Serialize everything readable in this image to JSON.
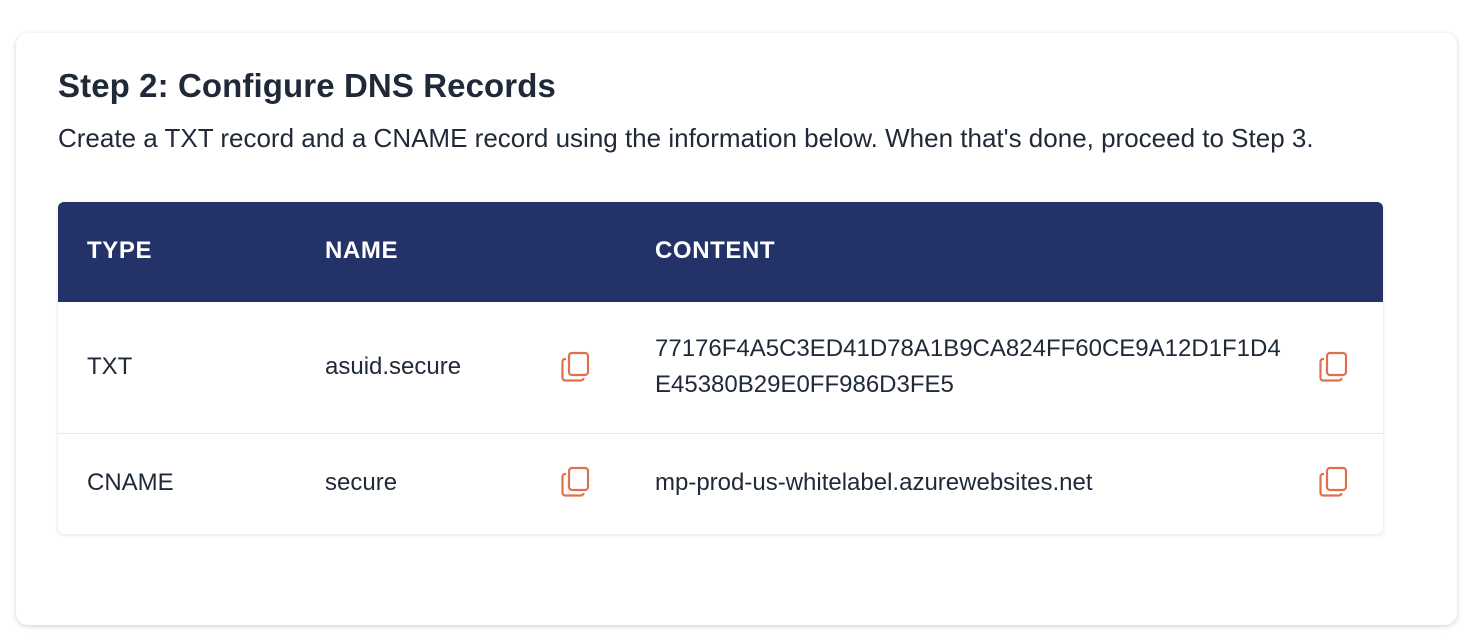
{
  "step": {
    "title": "Step 2: Configure DNS Records",
    "description": "Create a TXT record and a CNAME record using the information below. When that's done, proceed to Step 3."
  },
  "table": {
    "headers": {
      "type": "TYPE",
      "name": "NAME",
      "content": "CONTENT"
    },
    "rows": [
      {
        "type": "TXT",
        "name": "asuid.secure",
        "content": "77176F4A5C3ED41D78A1B9CA824FF60CE9A12D1F1D4E45380B29E0FF986D3FE5"
      },
      {
        "type": "CNAME",
        "name": "secure",
        "content": "mp-prod-us-whitelabel.azurewebsites.net"
      }
    ]
  },
  "icons": {
    "copy": "copy-icon"
  },
  "colors": {
    "header_bg": "#23336a",
    "copy_icon": "#e0704b"
  }
}
